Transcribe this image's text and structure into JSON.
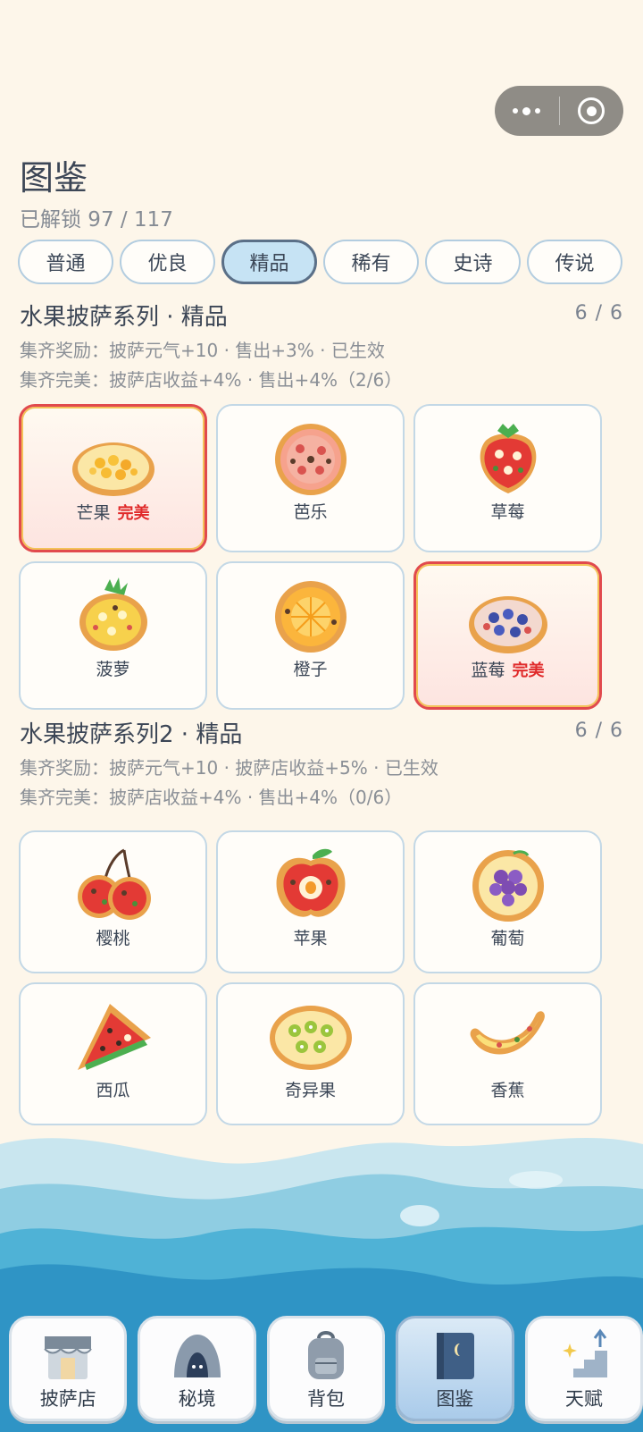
{
  "header": {
    "title": "图鉴",
    "unlocked": "已解锁 97 / 117"
  },
  "tabs": [
    {
      "label": "普通",
      "active": false
    },
    {
      "label": "优良",
      "active": false
    },
    {
      "label": "精品",
      "active": true
    },
    {
      "label": "稀有",
      "active": false
    },
    {
      "label": "史诗",
      "active": false
    },
    {
      "label": "传说",
      "active": false
    }
  ],
  "sections": [
    {
      "title": "水果披萨系列 · 精品",
      "count": "6 / 6",
      "reward": "集齐奖励：披萨元气+10 · 售出+3% · 已生效",
      "perfect": "集齐完美：披萨店收益+4% · 售出+4%（2/6）",
      "items": [
        {
          "name": "芒果",
          "badge": "完美",
          "icon": "mango-pizza-icon"
        },
        {
          "name": "芭乐",
          "badge": "",
          "icon": "guava-pizza-icon"
        },
        {
          "name": "草莓",
          "badge": "",
          "icon": "strawberry-pizza-icon"
        },
        {
          "name": "菠萝",
          "badge": "",
          "icon": "pineapple-pizza-icon"
        },
        {
          "name": "橙子",
          "badge": "",
          "icon": "orange-pizza-icon"
        },
        {
          "name": "蓝莓",
          "badge": "完美",
          "icon": "blueberry-pizza-icon"
        }
      ]
    },
    {
      "title": "水果披萨系列2 · 精品",
      "count": "6 / 6",
      "reward": "集齐奖励：披萨元气+10 · 披萨店收益+5% · 已生效",
      "perfect": "集齐完美：披萨店收益+4% · 售出+4%（0/6）",
      "items": [
        {
          "name": "樱桃",
          "badge": "",
          "icon": "cherry-pizza-icon"
        },
        {
          "name": "苹果",
          "badge": "",
          "icon": "apple-pizza-icon"
        },
        {
          "name": "葡萄",
          "badge": "",
          "icon": "grape-pizza-icon"
        },
        {
          "name": "西瓜",
          "badge": "",
          "icon": "watermelon-pizza-icon"
        },
        {
          "name": "奇异果",
          "badge": "",
          "icon": "kiwi-pizza-icon"
        },
        {
          "name": "香蕉",
          "badge": "",
          "icon": "banana-pizza-icon"
        }
      ]
    }
  ],
  "bottom_nav": [
    {
      "label": "披萨店",
      "icon": "shop-icon",
      "active": false
    },
    {
      "label": "秘境",
      "icon": "cave-icon",
      "active": false
    },
    {
      "label": "背包",
      "icon": "backpack-icon",
      "active": false
    },
    {
      "label": "图鉴",
      "icon": "book-icon",
      "active": true
    },
    {
      "label": "天赋",
      "icon": "stairs-icon",
      "active": false
    }
  ],
  "colors": {
    "accent": "#c6e3f4",
    "perfect": "#e02a2a",
    "background": "#fdf6ea"
  }
}
